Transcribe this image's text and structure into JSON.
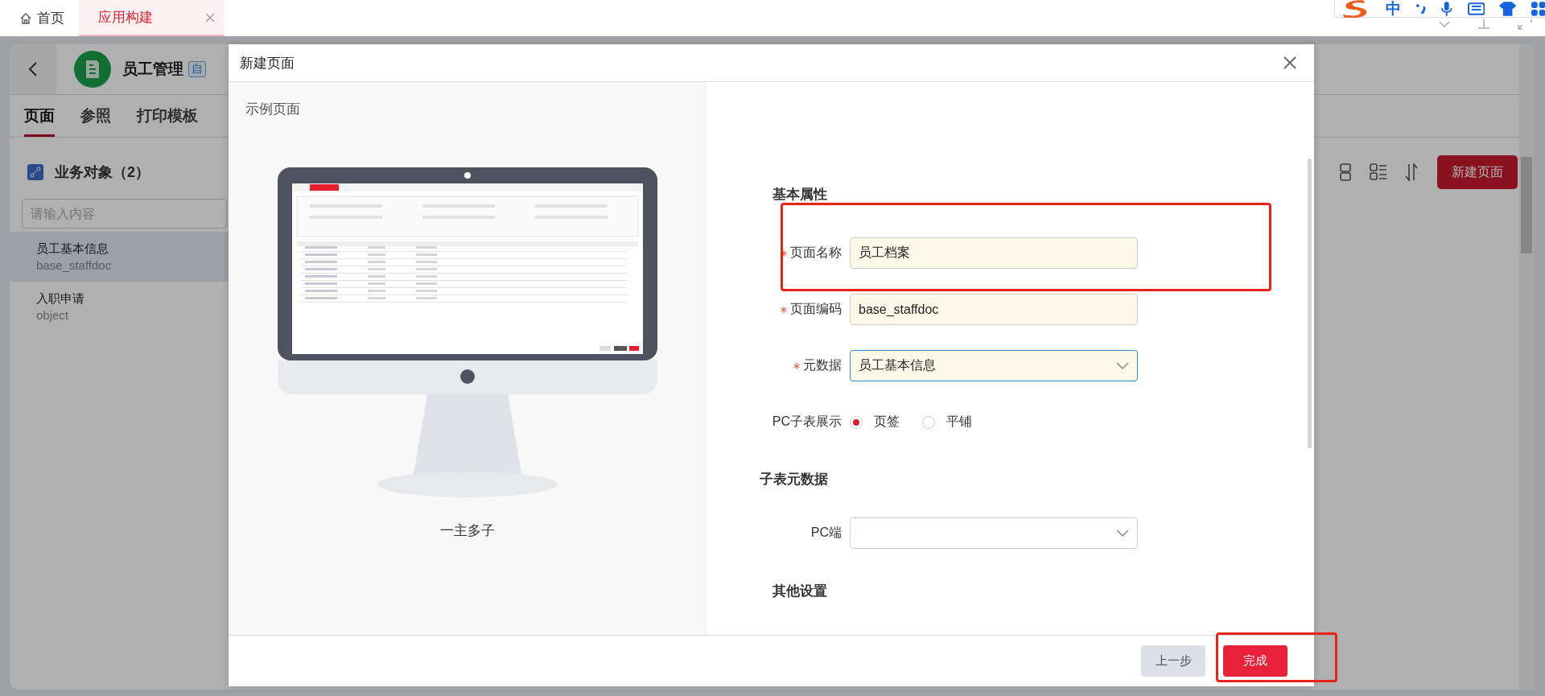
{
  "browser_tabs": [
    {
      "kind": "home",
      "label": "首页",
      "selected": false
    },
    {
      "kind": "page",
      "label": "应用构建",
      "selected": true
    }
  ],
  "ime_bar": {
    "mode": "中"
  },
  "app": {
    "title": "员工管理",
    "badge": "自",
    "tabs": [
      {
        "label": "页面",
        "selected": true
      },
      {
        "label": "参照",
        "selected": false
      },
      {
        "label": "打印模板",
        "selected": false
      }
    ],
    "section": "业务对象（2）",
    "search": {
      "placeholder": "请输入内容"
    },
    "objects": [
      {
        "name": "员工基本信息",
        "code": "base_staffdoc",
        "selected": true
      },
      {
        "name": "入职申请",
        "code": "object",
        "selected": false
      }
    ],
    "new_button": "新建页面"
  },
  "dialog": {
    "title": "新建页面",
    "preview": {
      "heading": "示例页面",
      "caption": "一主多子"
    },
    "sections": [
      {
        "title": "基本属性",
        "fields": [
          {
            "kind": "input",
            "label": "页面名称",
            "required": true,
            "value": "员工档案",
            "highlighted": true
          },
          {
            "kind": "input",
            "label": "页面编码",
            "required": true,
            "value": "base_staffdoc",
            "highlighted": false
          },
          {
            "kind": "select",
            "label": "元数据",
            "required": true,
            "value": "员工基本信息",
            "focused": true,
            "highlighted": false
          },
          {
            "kind": "radio",
            "label": "PC子表展示",
            "highlighted": false,
            "options": [
              {
                "label": "页签",
                "selected": true
              },
              {
                "label": "平铺",
                "selected": false
              }
            ]
          }
        ]
      },
      {
        "title": "子表元数据",
        "fields": [
          {
            "kind": "select",
            "label": "PC端",
            "required": false,
            "focused": false,
            "highlighted": false
          }
        ]
      },
      {
        "title": "其他设置"
      }
    ],
    "buttons": [
      {
        "kind": "secondary",
        "label": "上一步",
        "highlighted": false
      },
      {
        "kind": "primary",
        "label": "完成",
        "highlighted": true
      }
    ]
  }
}
